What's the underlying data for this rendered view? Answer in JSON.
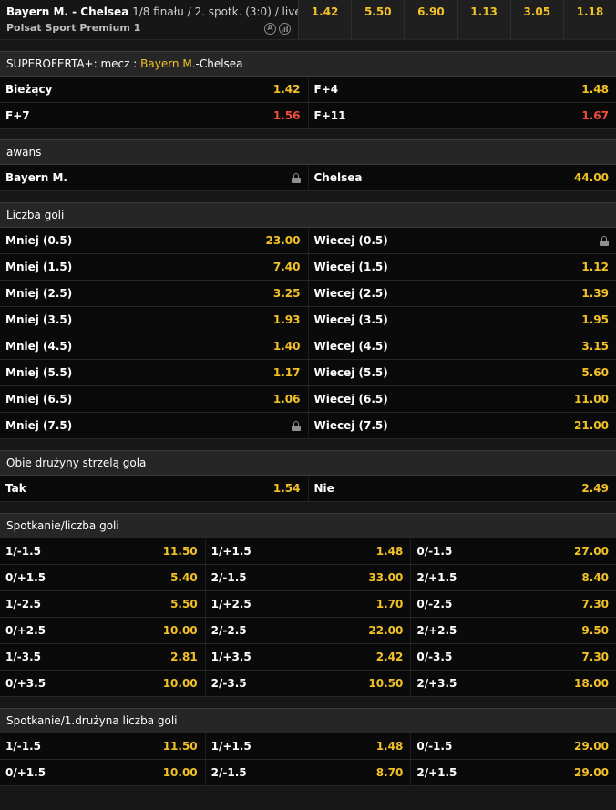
{
  "header": {
    "match": "Bayern M. - Chelsea",
    "info": " 1/8 finału / 2. spotk. (3:0) / live",
    "channel": "Polsat Sport Premium 1",
    "icon_a_label": "A",
    "odds": [
      "1.42",
      "5.50",
      "6.90",
      "1.13",
      "3.05",
      "1.18"
    ]
  },
  "superoferta": {
    "title_prefix": "SUPEROFERTA+: mecz : ",
    "title_team": "Bayern M.",
    "title_suffix": "-Chelsea",
    "rows": [
      [
        {
          "name": "Bieżący",
          "odd": "1.42"
        },
        {
          "name": "F+4",
          "odd": "1.48"
        }
      ],
      [
        {
          "name": "F+7",
          "odd": "1.56"
        },
        {
          "name": "F+11",
          "odd": "1.67"
        }
      ]
    ]
  },
  "awans": {
    "title": "awans",
    "rows": [
      [
        {
          "name": "Bayern M.",
          "locked": true
        },
        {
          "name": "Chelsea",
          "odd": "44.00"
        }
      ]
    ]
  },
  "goals": {
    "title": "Liczba goli",
    "rows": [
      [
        {
          "name": "Mniej (0.5)",
          "odd": "23.00"
        },
        {
          "name": "Wiecej (0.5)",
          "locked": true
        }
      ],
      [
        {
          "name": "Mniej (1.5)",
          "odd": "7.40"
        },
        {
          "name": "Wiecej (1.5)",
          "odd": "1.12"
        }
      ],
      [
        {
          "name": "Mniej (2.5)",
          "odd": "3.25"
        },
        {
          "name": "Wiecej (2.5)",
          "odd": "1.39"
        }
      ],
      [
        {
          "name": "Mniej (3.5)",
          "odd": "1.93"
        },
        {
          "name": "Wiecej (3.5)",
          "odd": "1.95"
        }
      ],
      [
        {
          "name": "Mniej (4.5)",
          "odd": "1.40"
        },
        {
          "name": "Wiecej (4.5)",
          "odd": "3.15"
        }
      ],
      [
        {
          "name": "Mniej (5.5)",
          "odd": "1.17"
        },
        {
          "name": "Wiecej (5.5)",
          "odd": "5.60"
        }
      ],
      [
        {
          "name": "Mniej (6.5)",
          "odd": "1.06"
        },
        {
          "name": "Wiecej (6.5)",
          "odd": "11.00"
        }
      ],
      [
        {
          "name": "Mniej (7.5)",
          "locked": true
        },
        {
          "name": "Wiecej (7.5)",
          "odd": "21.00"
        }
      ]
    ]
  },
  "btts": {
    "title": "Obie drużyny strzelą gola",
    "rows": [
      [
        {
          "name": "Tak",
          "odd": "1.54"
        },
        {
          "name": "Nie",
          "odd": "2.49"
        }
      ]
    ]
  },
  "match_goals": {
    "title": "Spotkanie/liczba goli",
    "rows": [
      [
        {
          "name": "1/-1.5",
          "odd": "11.50"
        },
        {
          "name": "1/+1.5",
          "odd": "1.48"
        },
        {
          "name": "0/-1.5",
          "odd": "27.00"
        }
      ],
      [
        {
          "name": "0/+1.5",
          "odd": "5.40"
        },
        {
          "name": "2/-1.5",
          "odd": "33.00"
        },
        {
          "name": "2/+1.5",
          "odd": "8.40"
        }
      ],
      [
        {
          "name": "1/-2.5",
          "odd": "5.50"
        },
        {
          "name": "1/+2.5",
          "odd": "1.70"
        },
        {
          "name": "0/-2.5",
          "odd": "7.30"
        }
      ],
      [
        {
          "name": "0/+2.5",
          "odd": "10.00"
        },
        {
          "name": "2/-2.5",
          "odd": "22.00"
        },
        {
          "name": "2/+2.5",
          "odd": "9.50"
        }
      ],
      [
        {
          "name": "1/-3.5",
          "odd": "2.81"
        },
        {
          "name": "1/+3.5",
          "odd": "2.42"
        },
        {
          "name": "0/-3.5",
          "odd": "7.30"
        }
      ],
      [
        {
          "name": "0/+3.5",
          "odd": "10.00"
        },
        {
          "name": "2/-3.5",
          "odd": "10.50"
        },
        {
          "name": "2/+3.5",
          "odd": "18.00"
        }
      ]
    ]
  },
  "match_team1_goals": {
    "title": "Spotkanie/1.drużyna liczba goli",
    "rows": [
      [
        {
          "name": "1/-1.5",
          "odd": "11.50"
        },
        {
          "name": "1/+1.5",
          "odd": "1.48"
        },
        {
          "name": "0/-1.5",
          "odd": "29.00"
        }
      ],
      [
        {
          "name": "0/+1.5",
          "odd": "10.00"
        },
        {
          "name": "2/-1.5",
          "odd": "8.70"
        },
        {
          "name": "2/+1.5",
          "odd": "29.00"
        }
      ]
    ]
  },
  "colors": {
    "odd": "#f2c128",
    "odd_drop": "#ee4d3b",
    "background": "#171717",
    "row": "#0a0a0a",
    "section_header": "#262626"
  }
}
